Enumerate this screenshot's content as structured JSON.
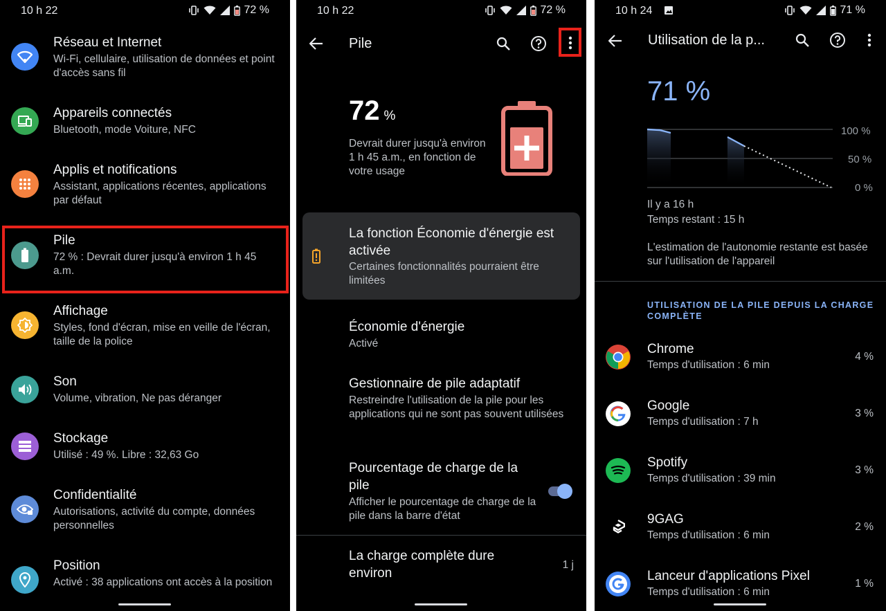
{
  "screen1": {
    "status": {
      "time": "10 h 22",
      "battery": "72 %"
    },
    "items": [
      {
        "title": "Réseau et Internet",
        "subtitle": "Wi-Fi, cellulaire, utilisation de données et point d'accès sans fil",
        "icon": "wifi-icon",
        "color": "#4285f4"
      },
      {
        "title": "Appareils connectés",
        "subtitle": "Bluetooth, mode Voiture, NFC",
        "icon": "devices-icon",
        "color": "#34a853"
      },
      {
        "title": "Applis et notifications",
        "subtitle": "Assistant, applications récentes, applications par défaut",
        "icon": "apps-icon",
        "color": "#f4813f"
      },
      {
        "title": "Pile",
        "subtitle": "72 % : Devrait durer jusqu'à environ 1 h 45 a.m.",
        "icon": "battery-icon",
        "color": "#4c9a8e"
      },
      {
        "title": "Affichage",
        "subtitle": "Styles, fond d'écran, mise en veille de l'écran, taille de la police",
        "icon": "brightness-icon",
        "color": "#f6b431"
      },
      {
        "title": "Son",
        "subtitle": "Volume, vibration, Ne pas déranger",
        "icon": "volume-icon",
        "color": "#3aa39a"
      },
      {
        "title": "Stockage",
        "subtitle": "Utilisé : 49 %. Libre : 32,63 Go",
        "icon": "storage-icon",
        "color": "#9c5fd6"
      },
      {
        "title": "Confidentialité",
        "subtitle": "Autorisations, activité du compte, données personnelles",
        "icon": "privacy-icon",
        "color": "#5e8bd8"
      },
      {
        "title": "Position",
        "subtitle": "Activé : 38 applications ont accès à la position",
        "icon": "location-icon",
        "color": "#3fa7c9"
      }
    ]
  },
  "screen2": {
    "status": {
      "time": "10 h 22",
      "battery": "72 %"
    },
    "title": "Pile",
    "battery_pct": "72",
    "battery_unit": "%",
    "battery_desc": "Devrait durer jusqu'à environ 1 h 45 a.m., en fonction de votre usage",
    "saver_card": {
      "title": "La fonction Économie d'énergie est activée",
      "subtitle": "Certaines fonctionnalités pourraient être limitées"
    },
    "saver": {
      "title": "Économie d'énergie",
      "subtitle": "Activé"
    },
    "adaptive": {
      "title": "Gestionnaire de pile adaptatif",
      "subtitle": "Restreindre l'utilisation de la pile pour les applications qui ne sont pas souvent utilisées"
    },
    "percentage": {
      "title": "Pourcentage de charge de la pile",
      "subtitle": "Afficher le pourcentage de charge de la pile dans la barre d'état",
      "enabled": true
    },
    "full_charge": {
      "title": "La charge complète dure environ",
      "value": "1 j"
    },
    "accent": "#e8817a"
  },
  "screen3": {
    "status": {
      "time": "10 h 24",
      "battery": "71 %"
    },
    "title": "Utilisation de la p...",
    "battery_pct": "71 %",
    "chart_ticks": [
      "100 %",
      "50 %",
      "0 %"
    ],
    "ago": "Il y a 16 h",
    "remaining": "Temps restant : 15 h",
    "estimate": "L'estimation de l'autonomie restante est basée sur l'utilisation de l'appareil",
    "section": "UTILISATION DE LA PILE DEPUIS LA CHARGE COMPLÈTE",
    "apps": [
      {
        "name": "Chrome",
        "usage": "Temps d'utilisation : 6 min",
        "pct": "4 %",
        "icon": "chrome-icon"
      },
      {
        "name": "Google",
        "usage": "Temps d'utilisation : 7 h",
        "pct": "3 %",
        "icon": "google-icon"
      },
      {
        "name": "Spotify",
        "usage": "Temps d'utilisation : 39 min",
        "pct": "3 %",
        "icon": "spotify-icon"
      },
      {
        "name": "9GAG",
        "usage": "Temps d'utilisation : 6 min",
        "pct": "2 %",
        "icon": "9gag-icon"
      },
      {
        "name": "Lanceur d'applications Pixel",
        "usage": "Temps d'utilisation : 6 min",
        "pct": "1 %",
        "icon": "pixel-launcher-icon"
      }
    ],
    "accent": "#8ab4f8"
  }
}
